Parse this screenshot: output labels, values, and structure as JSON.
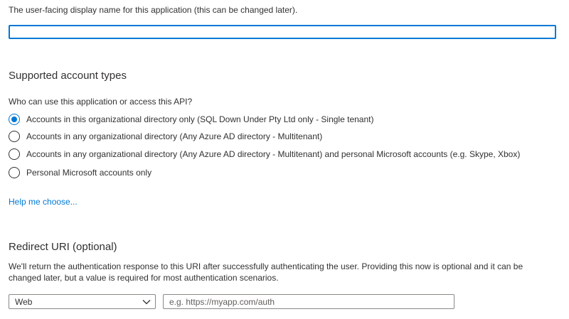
{
  "name_section": {
    "description": "The user-facing display name for this application (this can be changed later).",
    "input_value": ""
  },
  "account_types": {
    "title": "Supported account types",
    "question": "Who can use this application or access this API?",
    "options": [
      {
        "label": "Accounts in this organizational directory only (SQL Down Under Pty Ltd only - Single tenant)",
        "selected": true
      },
      {
        "label": "Accounts in any organizational directory (Any Azure AD directory - Multitenant)",
        "selected": false
      },
      {
        "label": "Accounts in any organizational directory (Any Azure AD directory - Multitenant) and personal Microsoft accounts (e.g. Skype, Xbox)",
        "selected": false
      },
      {
        "label": "Personal Microsoft accounts only",
        "selected": false
      }
    ],
    "help_link": "Help me choose..."
  },
  "redirect": {
    "title": "Redirect URI (optional)",
    "description_line1": "We'll return the authentication response to this URI after successfully authenticating the user. Providing this now is optional and it can be",
    "description_line2": "changed later, but a value is required for most authentication scenarios.",
    "platform_value": "Web",
    "uri_placeholder": "e.g. https://myapp.com/auth",
    "uri_value": ""
  },
  "colors": {
    "accent": "#0078d4",
    "text": "#323130",
    "border": "#8a8886"
  },
  "icons": {
    "select_chevron": "chevron-down-icon"
  }
}
